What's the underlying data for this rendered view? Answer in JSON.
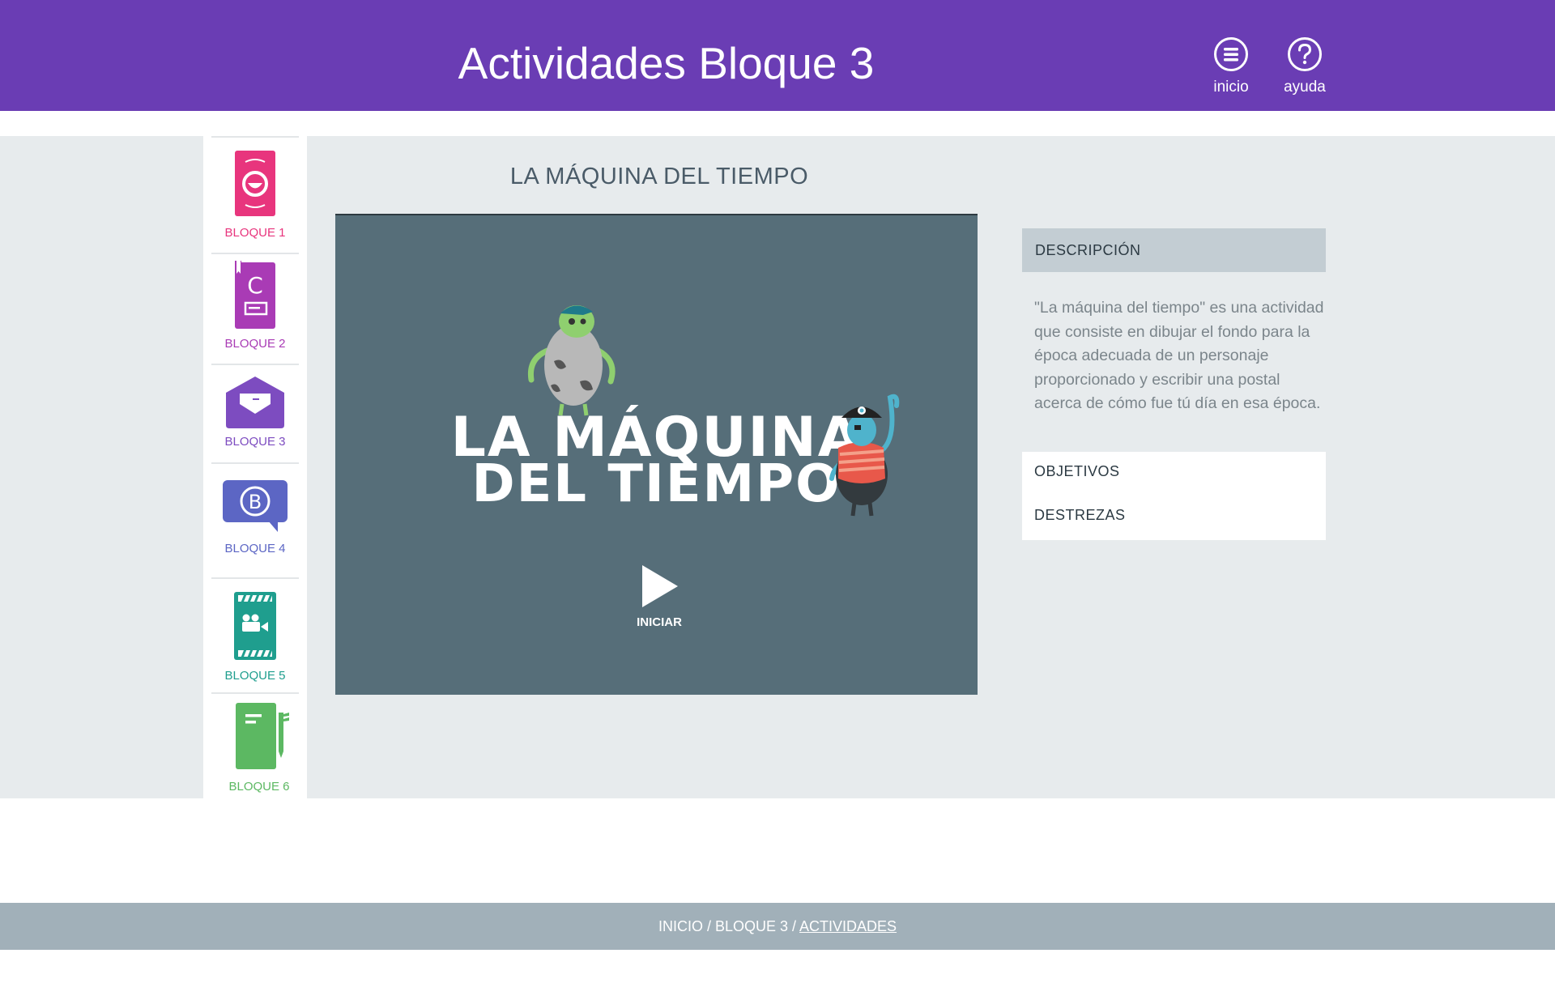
{
  "header": {
    "title": "Actividades Bloque 3",
    "buttons": {
      "home_label": "inicio",
      "help_label": "ayuda"
    }
  },
  "sidebar": {
    "items": [
      {
        "label": "BLOQUE 1",
        "color": "#e8357d",
        "icon": "face-card-icon"
      },
      {
        "label": "BLOQUE 2",
        "color": "#a93bb5",
        "icon": "letter-c-book-icon"
      },
      {
        "label": "BLOQUE 3",
        "color": "#7d4cc0",
        "icon": "envelope-icon"
      },
      {
        "label": "BLOQUE 4",
        "color": "#5c66c4",
        "icon": "speech-bubble-b-icon"
      },
      {
        "label": "BLOQUE 5",
        "color": "#1f9e8e",
        "icon": "video-camera-clapper-icon"
      },
      {
        "label": "BLOQUE 6",
        "color": "#5cb862",
        "icon": "notebook-pen-icon"
      }
    ]
  },
  "activity": {
    "title": "LA MÁQUINA DEL TIEMPO",
    "game_title_line1": "LA MÁQUINA",
    "game_title_line2": "DEL TIEMPO",
    "play_label": "INICIAR"
  },
  "info_panel": {
    "description_heading": "DESCRIPCIÓN",
    "description_text": "\"La máquina del tiempo\" es una actividad que consiste en dibujar el fondo para la época adecuada de un personaje proporcionado y escribir una postal acerca de cómo fue tú día en esa época.",
    "objectives_label": "OBJETIVOS",
    "skills_label": "DESTREZAS"
  },
  "breadcrumb": {
    "home": "INICIO",
    "separator": " / ",
    "block": "BLOQUE 3",
    "current": "ACTIVIDADES"
  },
  "colors": {
    "header_bg": "#6a3db4",
    "video_bg": "#566e79",
    "footer_bg": "#a1b0b9"
  }
}
